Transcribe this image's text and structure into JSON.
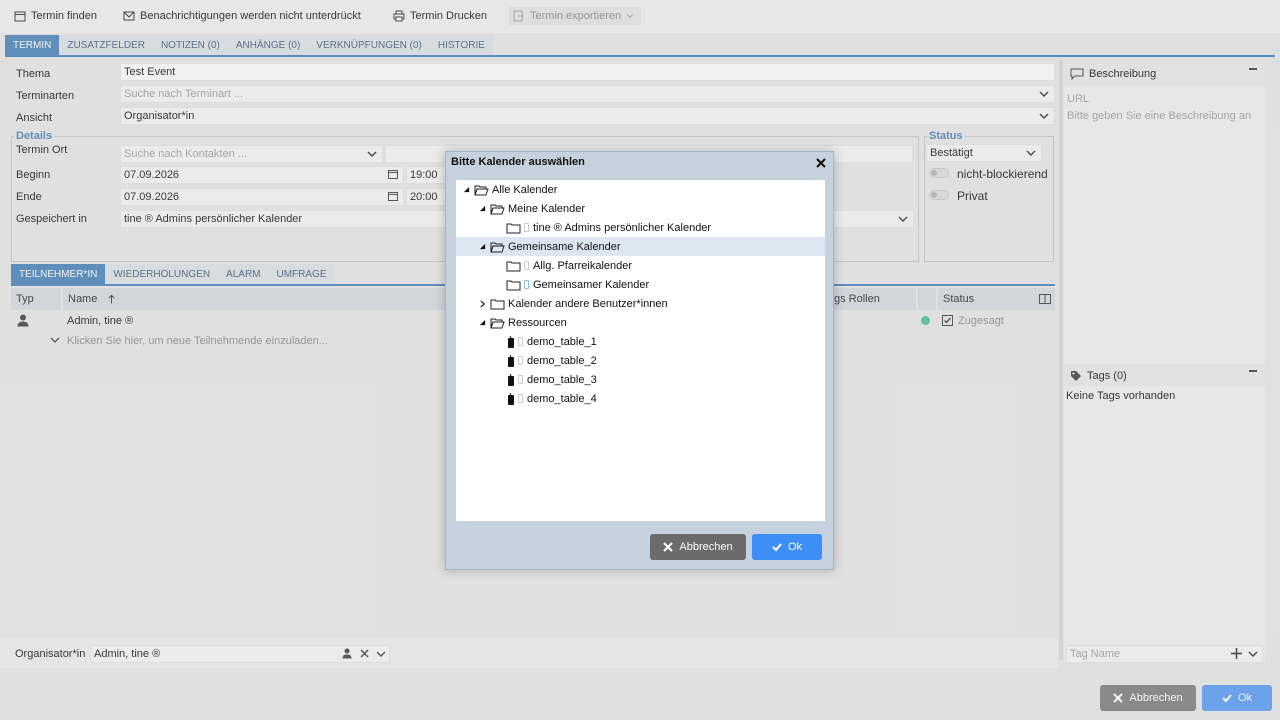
{
  "toolbar": {
    "find": "Termin finden",
    "notifications": "Benachrichtigungen werden nicht unterdrückt",
    "print": "Termin Drucken",
    "export": "Termin exportieren"
  },
  "tabs": [
    "TERMIN",
    "ZUSATZFELDER",
    "NOTIZEN (0)",
    "ANHÄNGE (0)",
    "VERKNÜPFUNGEN (0)",
    "HISTORIE"
  ],
  "form": {
    "thema_label": "Thema",
    "thema_value": "Test Event",
    "terminarten_label": "Terminarten",
    "terminarten_placeholder": "Suche nach Terminart ...",
    "ansicht_label": "Ansicht",
    "ansicht_value": "Organisator*in"
  },
  "details": {
    "legend": "Details",
    "ort_label": "Termin Ort",
    "ort_placeholder": "Suche nach Kontakten ...",
    "beginn_label": "Beginn",
    "beginn_date": "07.09.2026",
    "beginn_time": "19:00",
    "ende_label": "Ende",
    "ende_date": "07.09.2026",
    "ende_time": "20:00",
    "gespeichert_label": "Gespeichert in",
    "gespeichert_value": "tine ® Admins persönlicher Kalender"
  },
  "status": {
    "legend": "Status",
    "value": "Bestätigt",
    "toggle1": "nicht-blockierend",
    "toggle2": "Privat"
  },
  "subtabs": [
    "TEILNEHMER*IN",
    "WIEDERHOLUNGEN",
    "ALARM",
    "UMFRAGE"
  ],
  "grid": {
    "col_typ": "Typ",
    "col_name": "Name",
    "col_rollen": "gs Rollen",
    "col_status": "Status",
    "row_name": "Admin, tine ®",
    "row_status": "Zugesagt",
    "invite_hint": "Klicken Sie hier, um neue Teilnehmende einzuladen..."
  },
  "side": {
    "beschreibung": "Beschreibung",
    "url_placeholder": "URL",
    "desc_placeholder": "Bitte geben Sie eine Beschreibung an",
    "tags": "Tags (0)",
    "no_tags": "Keine Tags vorhanden",
    "tag_placeholder": "Tag Name"
  },
  "footer": {
    "organisator_label": "Organisator*in",
    "organisator_value": "Admin, tine ®",
    "cancel": "Abbrechen",
    "ok": "Ok"
  },
  "dialog": {
    "title": "Bitte Kalender auswählen",
    "nodes": [
      {
        "label": "Alle Kalender"
      },
      {
        "label": "Meine Kalender"
      },
      {
        "label": "tine ® Admins persönlicher Kalender"
      },
      {
        "label": "Gemeinsame Kalender"
      },
      {
        "label": "Allg. Pfarreikalender"
      },
      {
        "label": "Gemeinsamer Kalender"
      },
      {
        "label": "Kalender andere Benutzer*innen"
      },
      {
        "label": "Ressourcen"
      },
      {
        "label": "demo_table_1"
      },
      {
        "label": "demo_table_2"
      },
      {
        "label": "demo_table_3"
      },
      {
        "label": "demo_table_4"
      }
    ],
    "cancel": "Abbrechen",
    "ok": "Ok"
  },
  "colors": {
    "accent": "#5d90c1",
    "primary_button": "#3d8ef5",
    "accepted": "#5dc8a0"
  }
}
